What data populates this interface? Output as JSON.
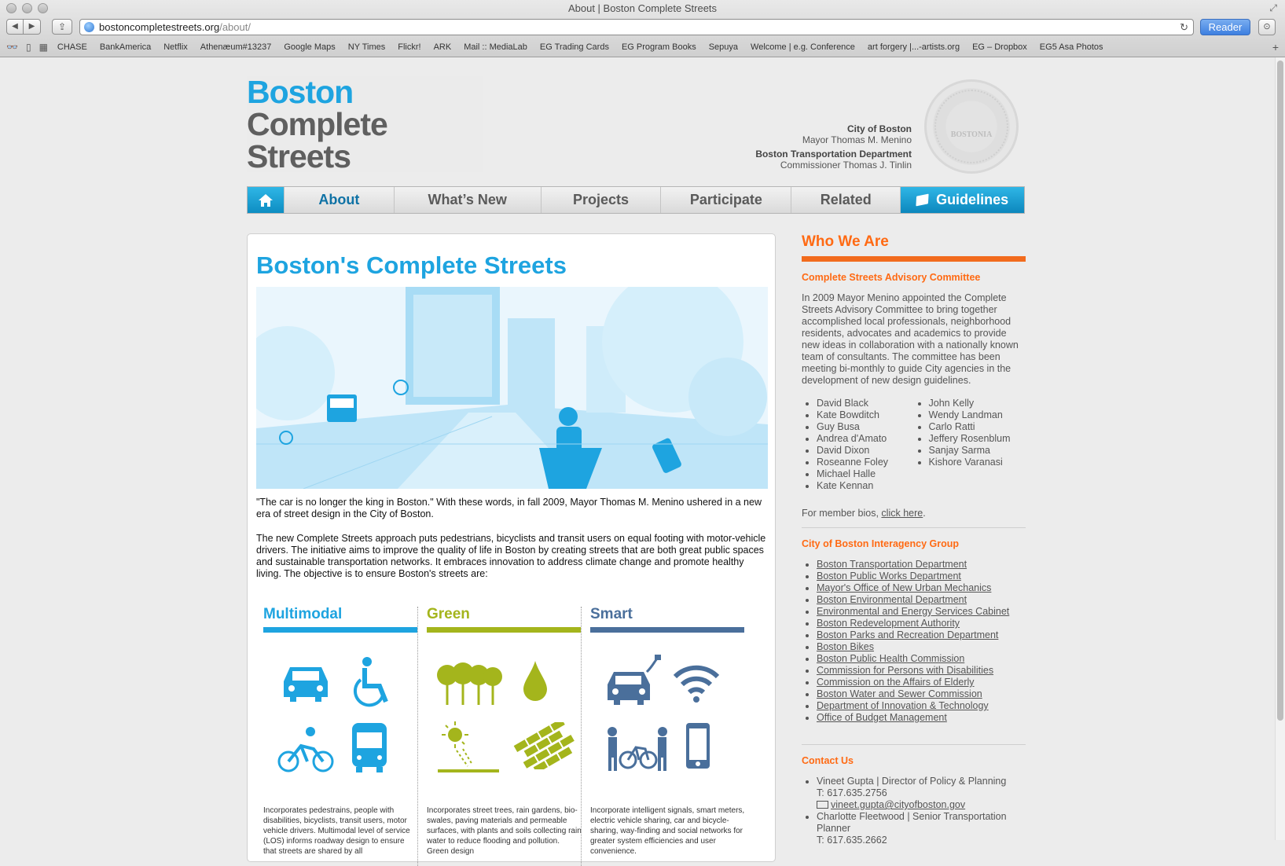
{
  "browser": {
    "window_title": "About | Boston Complete Streets",
    "url_host": "bostoncompletestreets.org",
    "url_path": "/about/",
    "reader_label": "Reader",
    "bookmarks": [
      "CHASE",
      "BankAmerica",
      "Netflix",
      "Athenæum#13237",
      "Google Maps",
      "NY Times",
      "Flickr!",
      "ARK",
      "Mail :: MediaLab",
      "EG Trading Cards",
      "EG Program Books",
      "Sepuya",
      "Welcome | e.g. Conference",
      "art forgery |...-artists.org",
      "EG – Dropbox",
      "EG5 Asa Photos"
    ]
  },
  "header": {
    "logo": [
      "Boston",
      "Complete",
      "Streets"
    ],
    "city_name": "City of Boston",
    "mayor": "Mayor Thomas M. Menino",
    "dept_name": "Boston Transportation Department",
    "commissioner": "Commissioner Thomas J. Tinlin",
    "seal_text": "BOSTONIA"
  },
  "nav": {
    "about": "About",
    "whats_new": "What’s New",
    "projects": "Projects",
    "participate": "Participate",
    "related": "Related",
    "guidelines": "Guidelines"
  },
  "main": {
    "title": "Boston's Complete Streets",
    "intro_1": "\"The car is no longer the king in Boston.\" With these words, in fall 2009, Mayor Thomas M. Menino ushered in a new era of street design in the City of Boston.",
    "intro_2": "The new Complete Streets approach puts pedestrians, bicyclists and transit users on equal footing with motor-vehicle drivers. The initiative aims to improve the quality of life in Boston by creating streets that are both great public spaces and sustainable transportation networks. It embraces innovation to address climate change and promote healthy living. The objective is to ensure Boston's streets are:",
    "columns": [
      {
        "title": "Multimodal",
        "color": "#1ea4e0",
        "desc": "Incorporates pedestrains, people with disabilities, bicyclists, transit users, motor vehicle drivers. Multimodal level of service (LOS) informs roadway design to ensure that streets are shared by all"
      },
      {
        "title": "Green",
        "color": "#a4b51c",
        "desc": "Incorporates street trees, rain gardens, bio-swales, paving materials and permeable surfaces, with plants and soils collecting rain water to reduce flooding and pollution. Green design"
      },
      {
        "title": "Smart",
        "color": "#4a6f9b",
        "desc": "Incorporate intelligent signals, smart meters, electric vehicle sharing, car and bicycle-sharing, way-finding and social networks for greater system efficiencies and user convenience."
      }
    ]
  },
  "sidebar": {
    "title": "Who We Are",
    "committee_heading": "Complete Streets Advisory Committee",
    "committee_text": "In 2009 Mayor Menino appointed the Complete Streets Advisory Committee to bring together accomplished local professionals, neighborhood residents, advocates and academics to provide new ideas in collaboration with a nationally known team of consultants. The committee has been meeting bi-monthly to guide City agencies in the development of new design guidelines.",
    "members_left": [
      "David Black",
      "Kate Bowditch",
      "Guy Busa",
      "Andrea d'Amato",
      "David Dixon",
      "Roseanne Foley",
      "Michael Halle",
      "Kate Kennan"
    ],
    "members_right": [
      "John Kelly",
      "Wendy Landman",
      "Carlo Ratti",
      "Jeffery Rosenblum",
      "Sanjay Sarma",
      "Kishore Varanasi"
    ],
    "bios_prefix": "For member bios, ",
    "bios_link": "click here",
    "bios_suffix": ".",
    "interagency_heading": "City of Boston Interagency Group",
    "interagency": [
      "Boston Transportation Department",
      "Boston Public Works Department",
      "Mayor's Office of New Urban Mechanics",
      "Boston Environmental Department",
      "Environmental and Energy Services Cabinet",
      "Boston Redevelopment Authority",
      "Boston Parks and Recreation Department",
      "Boston Bikes",
      "Boston Public Health Commission",
      "Commission for Persons with Disabilities",
      "Commission on the Affairs of Elderly",
      "Boston Water and Sewer Commission",
      "Department of Innovation & Technology",
      "Office of Budget Management"
    ],
    "contact_heading": "Contact Us",
    "contact1_name": "Vineet Gupta | Director of Policy & Planning",
    "contact1_phone": "T: 617.635.2756",
    "contact1_email": "vineet.gupta@cityofboston.gov",
    "contact2_name": "Charlotte Fleetwood | Senior Transportation Planner",
    "contact2_phone": "T: 617.635.2662"
  }
}
